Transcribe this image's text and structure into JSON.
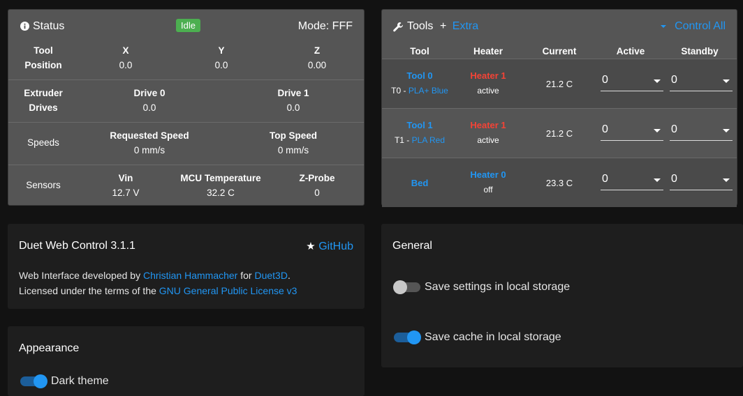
{
  "status": {
    "title": "Status",
    "state": "Idle",
    "mode": "Mode: FFF",
    "position": {
      "label_line1": "Tool",
      "label_line2": "Position",
      "axes": [
        {
          "name": "X",
          "value": "0.0"
        },
        {
          "name": "Y",
          "value": "0.0"
        },
        {
          "name": "Z",
          "value": "0.00"
        }
      ]
    },
    "extruder": {
      "label_line1": "Extruder",
      "label_line2": "Drives",
      "drives": [
        {
          "name": "Drive 0",
          "value": "0.0"
        },
        {
          "name": "Drive 1",
          "value": "0.0"
        }
      ]
    },
    "speeds": {
      "label": "Speeds",
      "requested_label": "Requested Speed",
      "requested_value": "0 mm/s",
      "top_label": "Top Speed",
      "top_value": "0 mm/s"
    },
    "sensors": {
      "label": "Sensors",
      "items": [
        {
          "name": "Vin",
          "value": "12.7 V"
        },
        {
          "name": "MCU Temperature",
          "value": "32.2 C"
        },
        {
          "name": "Z-Probe",
          "value": "0"
        }
      ]
    }
  },
  "tools": {
    "title": "Tools",
    "extra_label": "Extra",
    "control_all_label": "Control All",
    "headers": [
      "Tool",
      "Heater",
      "Current",
      "Active",
      "Standby"
    ],
    "rows": [
      {
        "tool": "Tool 0",
        "sub_prefix": "T0 - ",
        "sub_link": "PLA+ Blue",
        "heater": "Heater 1",
        "heater_state": "active",
        "current": "21.2 C",
        "active": "0",
        "standby": "0"
      },
      {
        "tool": "Tool 1",
        "sub_prefix": "T1 - ",
        "sub_link": "PLA Red",
        "heater": "Heater 1",
        "heater_state": "active",
        "current": "21.2 C",
        "active": "0",
        "standby": "0"
      },
      {
        "tool": "Bed",
        "sub_prefix": "",
        "sub_link": "",
        "heater": "Heater 0",
        "heater_state": "off",
        "current": "23.3 C",
        "active": "0",
        "standby": "0"
      }
    ],
    "colors": {
      "heater_active": "#f44336",
      "heater_off": "#2196f3"
    }
  },
  "about": {
    "title": "Duet Web Control 3.1.1",
    "github_label": "GitHub",
    "line1_prefix": "Web Interface developed by ",
    "line1_author": "Christian Hammacher",
    "line1_mid": " for ",
    "line1_org": "Duet3D",
    "line1_suffix": ".",
    "line2_prefix": "Licensed under the terms of the ",
    "line2_license": "GNU General Public License v3"
  },
  "general": {
    "title": "General",
    "save_settings_label": "Save settings in local storage",
    "save_settings_on": false,
    "save_cache_label": "Save cache in local storage",
    "save_cache_on": true
  },
  "appearance": {
    "title": "Appearance",
    "dark_theme_label": "Dark theme"
  },
  "theme": {
    "accent": "#2196f3",
    "idle": "#4caf50",
    "card_grey": "#555555",
    "card_dark": "#1e1e1e"
  }
}
